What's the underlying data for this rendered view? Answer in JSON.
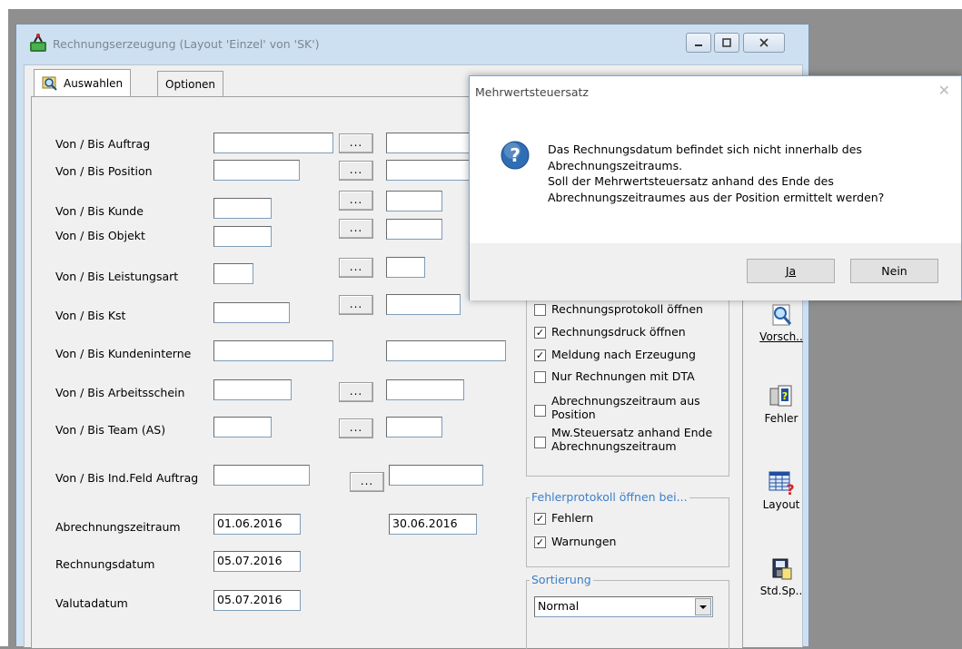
{
  "window": {
    "title": "Rechnungserzeugung  (Layout 'Einzel' von 'SK')"
  },
  "tabs": [
    "Auswahlen",
    "Optionen"
  ],
  "fields": {
    "auftrag_label": "Von / Bis Auftrag",
    "position_label": "Von / Bis Position",
    "kunde_label": "Von / Bis Kunde",
    "objekt_label": "Von / Bis Objekt",
    "leistungsart_label": "Von / Bis Leistungsart",
    "kst_label": "Von / Bis Kst",
    "kundeninterne_label": "Von / Bis Kundeninterne",
    "arbeitsschein_label": "Von / Bis Arbeitsschein",
    "team_label": "Von / Bis Team (AS)",
    "indfeld_label": "Von / Bis Ind.Feld Auftrag",
    "abrechnungszeitraum_label": "Abrechnungszeitraum",
    "abrechnungszeitraum_von": "01.06.2016",
    "abrechnungszeitraum_bis": "30.06.2016",
    "rechnungsdatum_label": "Rechnungsdatum",
    "rechnungsdatum": "05.07.2016",
    "valutadatum_label": "Valutadatum",
    "valutadatum": "05.07.2016",
    "dots_label": "..."
  },
  "options": [
    {
      "label": "Rechnungsprotokoll öffnen",
      "checked": false
    },
    {
      "label": "Rechnungsdruck öffnen",
      "checked": true
    },
    {
      "label": "Meldung nach Erzeugung",
      "checked": true
    },
    {
      "label": "Nur Rechnungen mit DTA",
      "checked": false
    },
    {
      "label": "Abrechnungszeitraum aus Position",
      "checked": false
    },
    {
      "label": "Mw.Steuersatz anhand Ende Abrechnungszeitraum",
      "checked": false
    }
  ],
  "fehlerprotokoll": {
    "title": "Fehlerprotokoll öffnen bei...",
    "fehlern": {
      "label": "Fehlern",
      "checked": true
    },
    "warnungen": {
      "label": "Warnungen",
      "checked": true
    }
  },
  "sortierung": {
    "title": "Sortierung",
    "selected": "Normal"
  },
  "side_buttons": {
    "vorschau": "Vorsch..",
    "fehler": "Fehler",
    "layout": "Layout",
    "stdsp": "Std.Sp.."
  },
  "dialog": {
    "title": "Mehrwertsteuersatz",
    "line1": "Das Rechnungsdatum befindet sich nicht innerhalb des",
    "line2": "Abrechnungszeitraums.",
    "line3": "Soll der Mehrwertsteuersatz anhand des Ende des",
    "line4": "Abrechnungszeitraumes aus der Position ermittelt werden?",
    "yes": "Ja",
    "no": "Nein"
  },
  "colors": {
    "window_frame": "#cde0f1",
    "group_title": "#3c7fc8",
    "question_icon": "#2f6db5"
  }
}
